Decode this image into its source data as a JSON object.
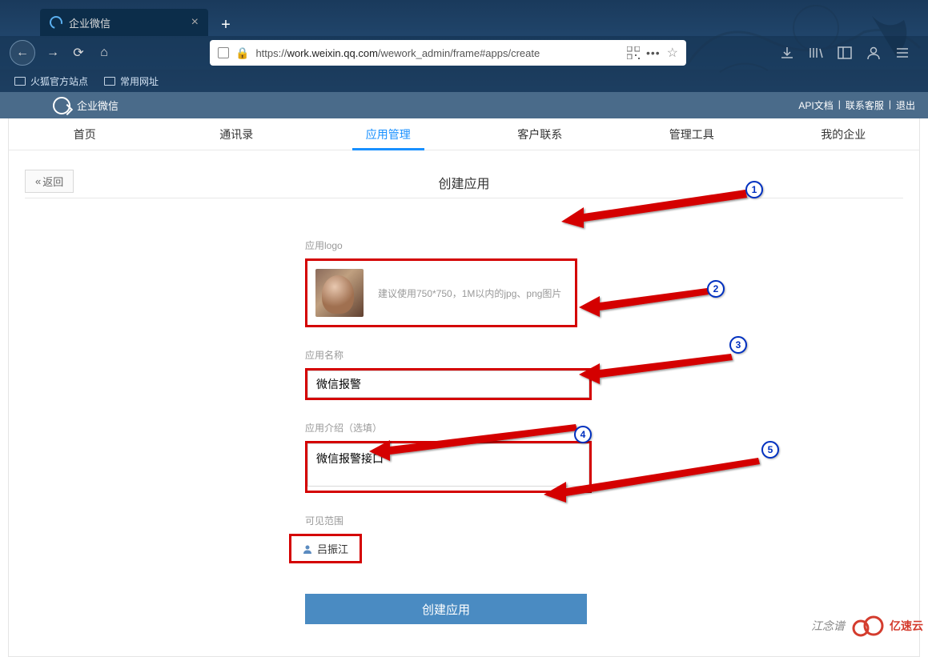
{
  "browser": {
    "tab_title": "企业微信",
    "url_prefix": "https://",
    "url_domain": "work.weixin.qq.com",
    "url_path": "/wework_admin/frame#apps/create",
    "bookmarks": [
      "火狐官方站点",
      "常用网址"
    ]
  },
  "app": {
    "brand": "企业微信",
    "header_links": [
      "API文档",
      "联系客服",
      "退出"
    ],
    "nav_tabs": [
      "首页",
      "通讯录",
      "应用管理",
      "客户联系",
      "管理工具",
      "我的企业"
    ],
    "active_tab_index": 2
  },
  "page": {
    "back_label": "返回",
    "title": "创建应用"
  },
  "form": {
    "logo": {
      "label": "应用logo",
      "hint": "建议使用750*750，1M以内的jpg、png图片"
    },
    "name": {
      "label": "应用名称",
      "value": "微信报警"
    },
    "desc": {
      "label": "应用介绍（选填）",
      "value": "微信报警接口"
    },
    "scope": {
      "label": "可见范围",
      "member": "吕振江"
    },
    "submit": "创建应用"
  },
  "annotations": [
    "1",
    "2",
    "3",
    "4",
    "5"
  ],
  "watermark": {
    "text": "江念谱",
    "brand": "亿速云"
  }
}
